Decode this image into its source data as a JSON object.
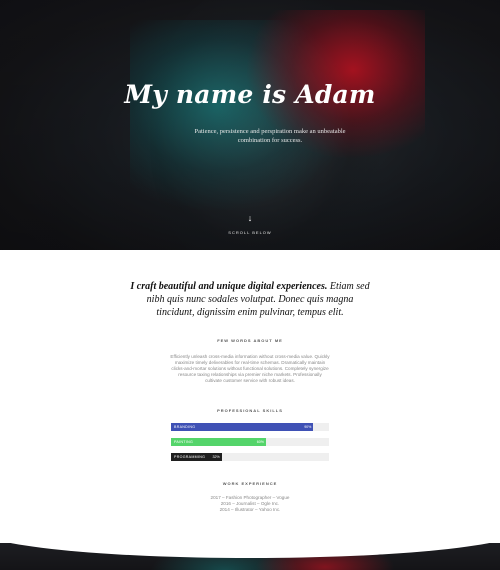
{
  "hero": {
    "title": "My name is Adam",
    "tagline": "Patience, persistence and perspiration make an unbeatable combination for success.",
    "scroll_icon": "arrow-down-icon",
    "scroll_label": "SCROLL BELOW",
    "accent_red": "#d21223",
    "accent_teal": "#199696"
  },
  "intro": {
    "bold": "I craft beautiful and unique digital experiences.",
    "rest": " Etiam sed nibh quis nunc sodales volutpat. Donec quis magna tincidunt, dignissim enim pulvinar, tempus elit."
  },
  "about": {
    "heading": "FEW WORDS ABOUT ME",
    "text": "Efficiently unleash cross-media information without cross-media value. Quickly maximize timely deliverables for real-time schemas. Dramatically maintain clicks-and-mortar solutions without functional solutions. Completely synergize resource taxing relationships via premier niche markets. Professionally cultivate customer service with robust ideas."
  },
  "skills": {
    "heading": "PROFESSIONAL SKILLS",
    "items": [
      {
        "name": "BRANDING",
        "value": 90,
        "label": "90%",
        "color": "#3f51b5"
      },
      {
        "name": "PAINTING",
        "value": 60,
        "label": "60%",
        "color": "#54d46a"
      },
      {
        "name": "PROGRAMMING",
        "value": 32,
        "label": "32%",
        "color": "#1f1f1f"
      }
    ]
  },
  "experience": {
    "heading": "WORK EXPERIENCE",
    "items": [
      "2017 – Fashion Photographer – Vogue",
      "2016 – Journalist – Ogle Inc.",
      "2014 – Illustrator – Yahoo Inc."
    ]
  }
}
